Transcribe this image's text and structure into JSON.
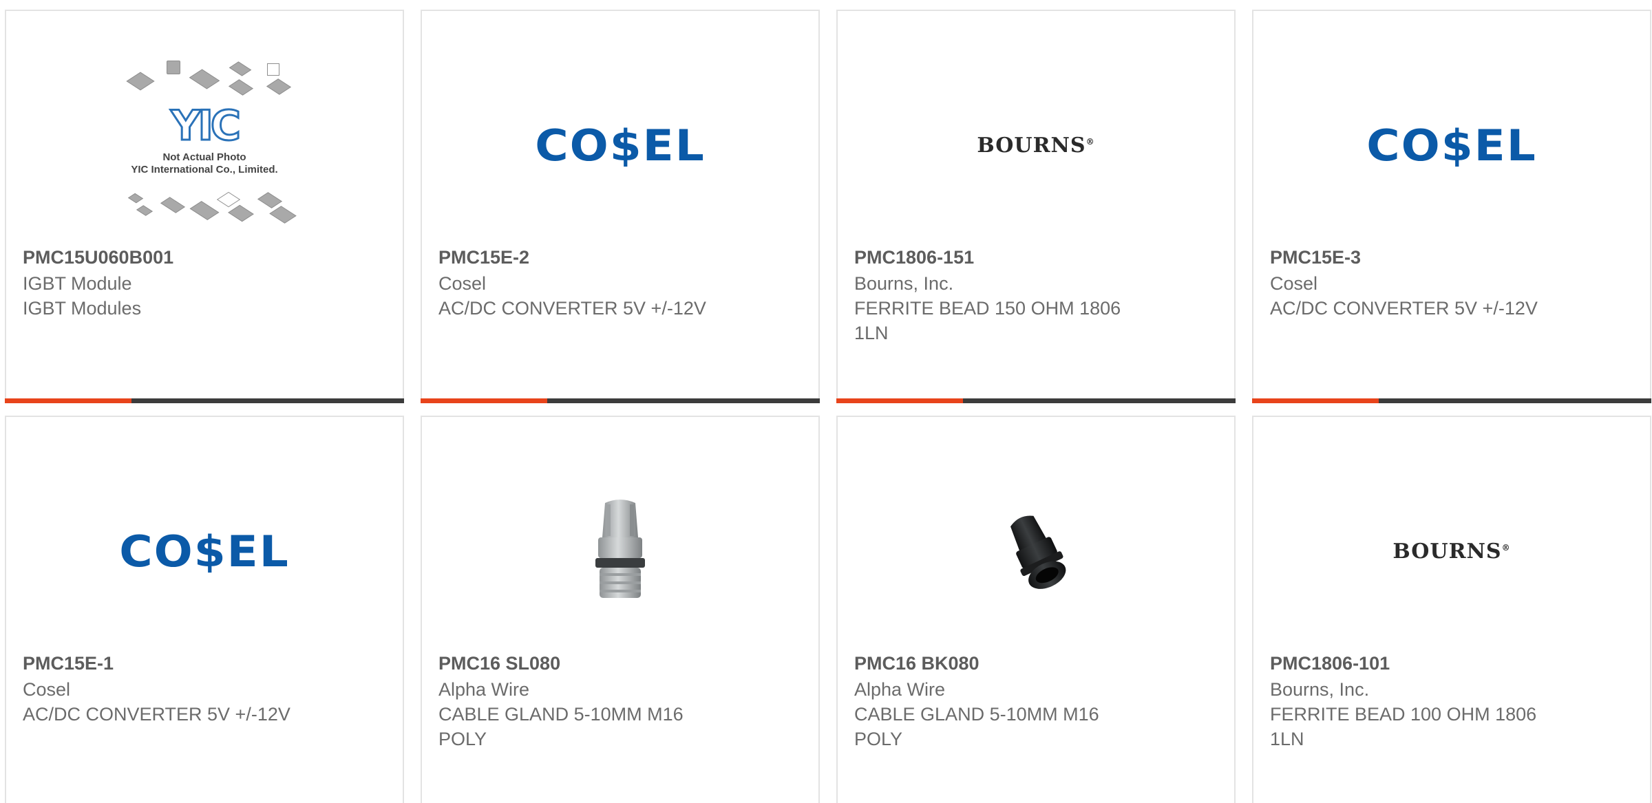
{
  "products": [
    {
      "part_number": "PMC15U060B001",
      "manufacturer": "IGBT Module",
      "description": "IGBT Modules",
      "image": "yic-placeholder",
      "image_caption": "Not Actual Photo\nYIC International Co., Limited.",
      "image_logo_text": "YIC"
    },
    {
      "part_number": "PMC15E-2",
      "manufacturer": "Cosel",
      "description": "AC/DC CONVERTER 5V +/-12V",
      "image": "cosel-logo",
      "logo_text": "CO$EL"
    },
    {
      "part_number": "PMC1806-151",
      "manufacturer": "Bourns, Inc.",
      "description": "FERRITE BEAD 150 OHM 1806\n1LN",
      "image": "bourns-logo",
      "logo_text": "BOURNS"
    },
    {
      "part_number": "PMC15E-3",
      "manufacturer": "Cosel",
      "description": "AC/DC CONVERTER 5V +/-12V",
      "image": "cosel-logo",
      "logo_text": "CO$EL"
    },
    {
      "part_number": "PMC15E-1",
      "manufacturer": "Cosel",
      "description": "AC/DC CONVERTER 5V +/-12V",
      "image": "cosel-logo",
      "logo_text": "CO$EL"
    },
    {
      "part_number": "PMC16 SL080",
      "manufacturer": "Alpha Wire",
      "description": "CABLE GLAND 5-10MM M16\nPOLY",
      "image": "cable-gland-gray"
    },
    {
      "part_number": "PMC16 BK080",
      "manufacturer": "Alpha Wire",
      "description": "CABLE GLAND 5-10MM M16\nPOLY",
      "image": "cable-gland-black"
    },
    {
      "part_number": "PMC1806-101",
      "manufacturer": "Bourns, Inc.",
      "description": "FERRITE BEAD 100 OHM 1806\n1LN",
      "image": "bourns-logo",
      "logo_text": "BOURNS"
    }
  ],
  "colors": {
    "accent": "#e8441b",
    "bar": "#3c3c3c",
    "cosel_blue": "#0b5aa8",
    "card_border": "#e3e3e3",
    "text": "#6b6b6b"
  }
}
